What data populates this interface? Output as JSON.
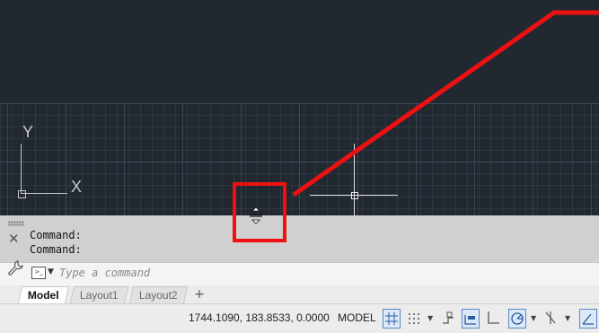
{
  "viewport": {
    "ucs": {
      "y_label": "Y",
      "x_label": "X"
    },
    "highlight_color": "#ee1111"
  },
  "command_history": {
    "lines": [
      "Command:",
      "Command:"
    ]
  },
  "command_input": {
    "placeholder": "Type a command"
  },
  "layout_tabs": [
    {
      "label": "Model",
      "active": true
    },
    {
      "label": "Layout1",
      "active": false
    },
    {
      "label": "Layout2",
      "active": false
    }
  ],
  "status_bar": {
    "coordinates": "1744.1090, 183.8533, 0.0000",
    "space": "MODEL",
    "toggles": [
      {
        "name": "grid-display",
        "on": true
      },
      {
        "name": "snap-mode",
        "on": false
      },
      {
        "name": "infer-constraints",
        "on": false
      },
      {
        "name": "dynamic-input",
        "on": true
      },
      {
        "name": "ortho-mode",
        "on": false
      },
      {
        "name": "polar-tracking",
        "on": true
      },
      {
        "name": "isometric-drafting",
        "on": false
      },
      {
        "name": "object-snap-tracking",
        "on": true
      }
    ]
  }
}
